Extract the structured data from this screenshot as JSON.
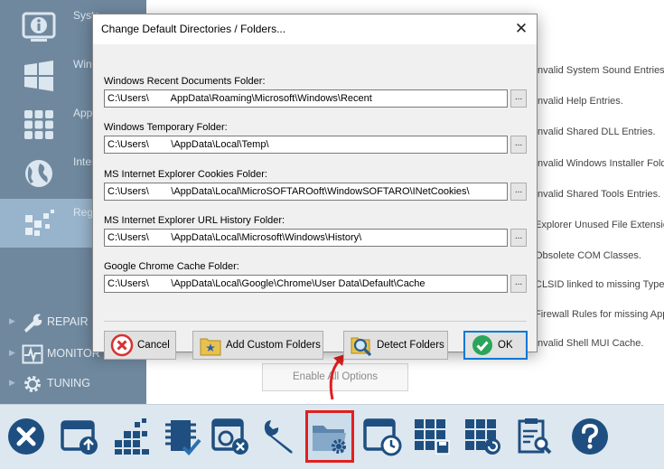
{
  "sidebar": {
    "items": [
      {
        "label": "System Status",
        "icon": "system-info-icon"
      },
      {
        "label": "Windows Optimizer",
        "icon": "windows-logo-icon"
      },
      {
        "label": "Apps Cleaner",
        "icon": "apps-grid-icon"
      },
      {
        "label": "Internet Browser",
        "icon": "globe-icon"
      },
      {
        "label": "Registry",
        "icon": "registry-blocks-icon"
      }
    ],
    "sections": [
      {
        "label": "REPAIR",
        "icon": "wrench-icon"
      },
      {
        "label": "MONITOR",
        "icon": "pulse-monitor-icon"
      },
      {
        "label": "TUNING",
        "icon": "gear-icon"
      }
    ]
  },
  "content": {
    "entries": [
      "Invalid System Sound Entries.",
      "Invalid Help Entries.",
      "Invalid Shared DLL Entries.",
      "Invalid Windows Installer Folders",
      "Invalid Shared Tools Entries.",
      "Explorer Unused File Extensions",
      "Obsolete COM Classes.",
      "CLSID linked to missing TypeLib",
      "Firewall Rules for missing Applications",
      "Invalid Shell MUI Cache."
    ],
    "enable_all_label": "Enable All Options"
  },
  "dialog": {
    "title": "Change Default Directories / Folders...",
    "close_glyph": "✕",
    "browse_label": "...",
    "folders": [
      {
        "label": "Windows Recent Documents Folder:",
        "value": "C:\\Users\\        AppData\\Roaming\\Microsoft\\Windows\\Recent"
      },
      {
        "label": "Windows Temporary Folder:",
        "value": "C:\\Users\\        \\AppData\\Local\\Temp\\"
      },
      {
        "label": "MS Internet Explorer Cookies Folder:",
        "value": "C:\\Users\\        \\AppData\\Local\\MicroSOFTAROoft\\WindowSOFTARO\\INetCookies\\"
      },
      {
        "label": "MS Internet Explorer URL History Folder:",
        "value": "C:\\Users\\        \\AppData\\Local\\Microsoft\\Windows\\History\\"
      },
      {
        "label": "Google Chrome Cache Folder:",
        "value": "C:\\Users\\        \\AppData\\Local\\Google\\Chrome\\User Data\\Default\\Cache"
      }
    ],
    "buttons": {
      "cancel": "Cancel",
      "add_custom": "Add Custom Folders",
      "detect": "Detect Folders",
      "ok": "OK"
    }
  },
  "toolbar": {
    "buttons": [
      "close-circle-icon",
      "window-upload-icon",
      "pixel-blocks-icon",
      "chip-check-icon",
      "disk-window-remove-icon",
      "wrench-icon",
      "folder-gear-icon",
      "window-clock-icon",
      "grid-save-icon",
      "grid-restore-icon",
      "clipboard-search-icon",
      "help-icon"
    ],
    "selected_index": 6
  },
  "colors": {
    "sidebar_bg": "#6f889e",
    "sidebar_active": "#98b4cc",
    "toolbar_icon": "#1e4f80",
    "highlight_red": "#e02020",
    "ok_green": "#2aa65a",
    "cancel_red": "#d93030"
  }
}
